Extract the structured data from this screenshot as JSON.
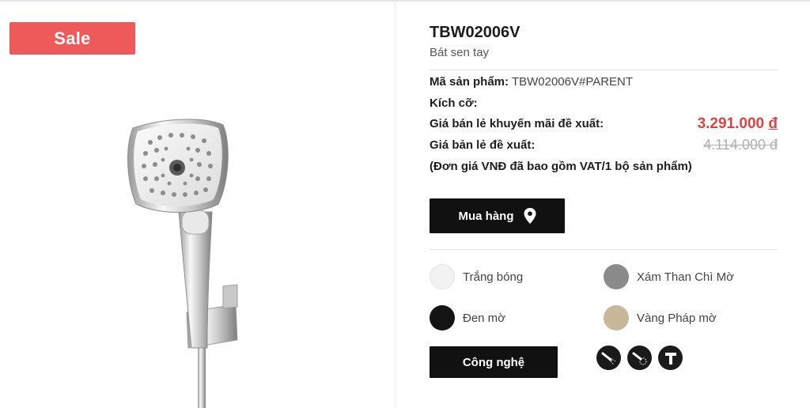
{
  "sale_badge": "Sale",
  "product": {
    "title": "TBW02006V",
    "subtitle": "Bát sen tay",
    "sku_label": "Mã sản phẩm:",
    "sku_value": "TBW02006V#PARENT",
    "size_label": "Kích cỡ:",
    "promo_price_label": "Giá bán lẻ khuyến mãi đề xuất:",
    "promo_price_value": "3.291.000",
    "currency": "đ",
    "retail_price_label": "Giá bản lẻ đề xuất:",
    "retail_price_value": "4.114.000 đ",
    "vat_note": "(Đơn giá VNĐ đã bao gồm VAT/1 bộ sản phẩm)"
  },
  "buttons": {
    "buy_label": "Mua hàng",
    "technology_label": "Công nghệ"
  },
  "colors": [
    {
      "name": "Trắng bóng",
      "hex": "#f2f2f2"
    },
    {
      "name": "Xám Than Chì Mờ",
      "hex": "#8a8a8a"
    },
    {
      "name": "Đen mờ",
      "hex": "#141414"
    },
    {
      "name": "Vàng Pháp mờ",
      "hex": "#c9b79a"
    }
  ],
  "tech_icons": [
    "shower-spray-icon",
    "shower-massage-icon",
    "faucet-t-icon"
  ],
  "theme": {
    "accent_sale": "#e04343",
    "badge_bg": "#ee5a5a",
    "button_bg": "#111111"
  }
}
